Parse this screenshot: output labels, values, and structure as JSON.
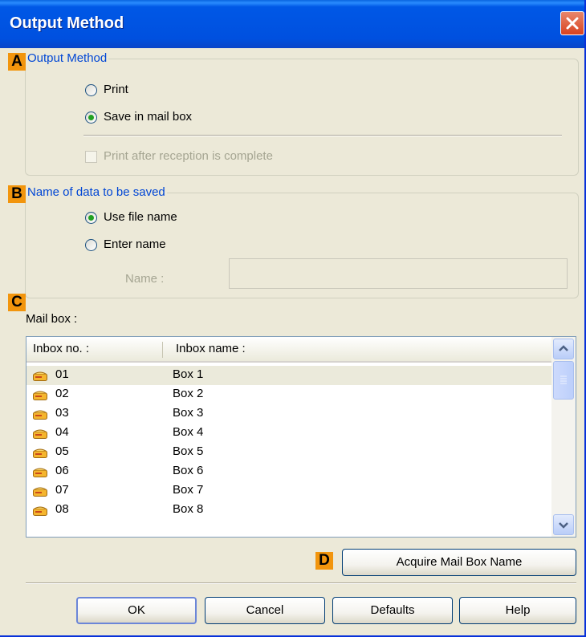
{
  "window": {
    "title": "Output Method"
  },
  "markers": {
    "a": "A",
    "b": "B",
    "c": "C",
    "d": "D"
  },
  "output_method": {
    "group_title": "Output Method",
    "options": [
      {
        "label": "Print",
        "checked": false
      },
      {
        "label": "Save in mail box",
        "checked": true
      }
    ],
    "print_after_reception": {
      "label": "Print after reception is complete",
      "checked": false,
      "enabled": false
    }
  },
  "name_of_data": {
    "group_title": "Name of data to be saved",
    "options": [
      {
        "label": "Use file name",
        "checked": true
      },
      {
        "label": "Enter name",
        "checked": false
      }
    ],
    "name_label": "Name :",
    "name_value": ""
  },
  "mail_box": {
    "label": "Mail box :",
    "columns": [
      "Inbox no. :",
      "Inbox name :"
    ],
    "rows": [
      {
        "no": "01",
        "name": "Box 1",
        "selected": true
      },
      {
        "no": "02",
        "name": "Box 2",
        "selected": false
      },
      {
        "no": "03",
        "name": "Box 3",
        "selected": false
      },
      {
        "no": "04",
        "name": "Box 4",
        "selected": false
      },
      {
        "no": "05",
        "name": "Box 5",
        "selected": false
      },
      {
        "no": "06",
        "name": "Box 6",
        "selected": false
      },
      {
        "no": "07",
        "name": "Box 7",
        "selected": false
      },
      {
        "no": "08",
        "name": "Box 8",
        "selected": false
      }
    ]
  },
  "buttons": {
    "acquire": "Acquire Mail Box Name",
    "ok": "OK",
    "cancel": "Cancel",
    "defaults": "Defaults",
    "help": "Help"
  },
  "colors": {
    "marker": "#f2950d",
    "group_title": "#0046d5",
    "titlebar": "#0050df"
  }
}
